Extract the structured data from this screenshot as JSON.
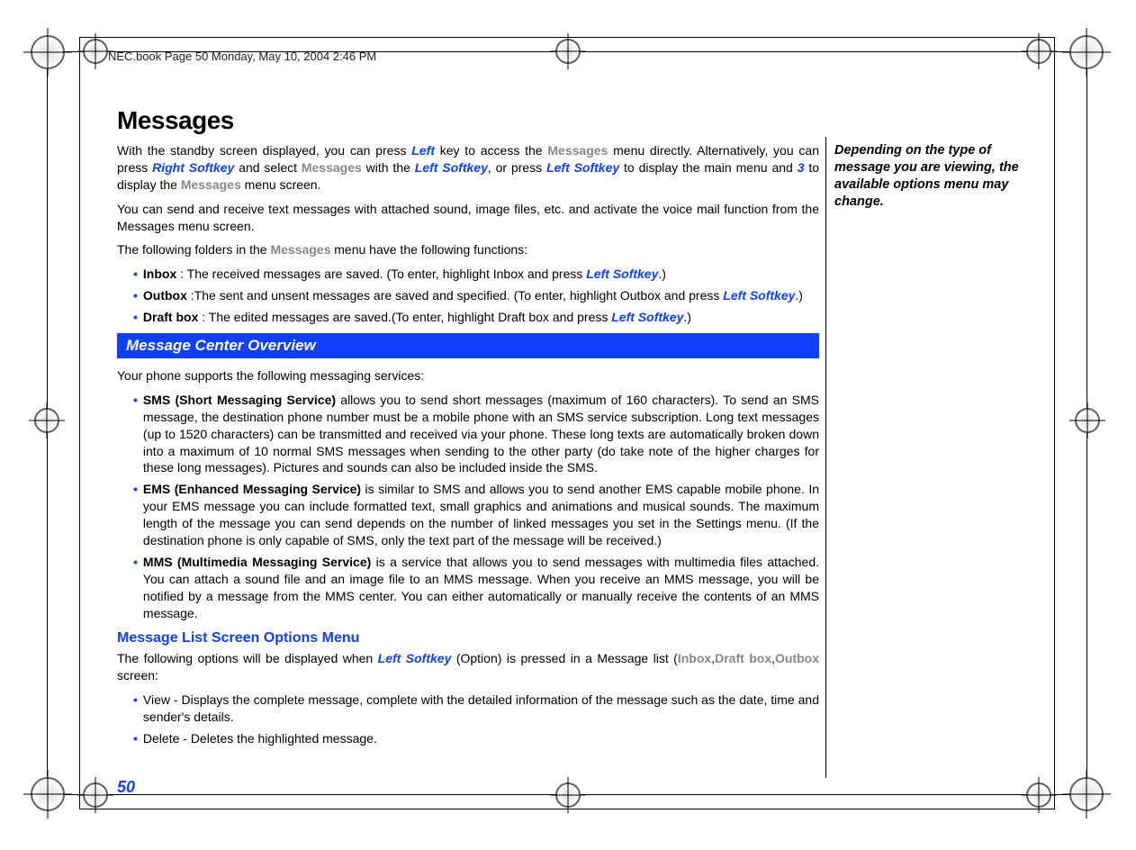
{
  "header": "NEC.book  Page 50  Monday, May 10, 2004  2:46 PM",
  "title": "Messages",
  "intro": {
    "p1_a": "With the standby screen displayed, you can press ",
    "k_left": "Left",
    "p1_b": " key to access the ",
    "ui_messages": "Messages",
    "p1_c": " menu directly. Alternatively, you can press ",
    "k_right_soft": "Right  Softkey",
    "p1_d": " and select ",
    "p1_e": " with the ",
    "k_left_soft": "Left Softkey",
    "p1_f": ", or press ",
    "p1_g": " to display the main menu and ",
    "k_3": "3",
    "p1_h": " to display the ",
    "p1_i": " menu screen."
  },
  "p2": "You can send and receive text messages with attached sound, image files, etc. and activate the voice mail function from the Messages menu screen.",
  "p3_a": "The following folders in the ",
  "p3_b": " menu have the following functions:",
  "folders": {
    "inbox_label": "Inbox",
    "inbox_text_a": " : The received messages are saved. (To enter, highlight Inbox and press ",
    "inbox_text_b": ".)",
    "outbox_label": "Outbox",
    "outbox_text_a": " :The sent and unsent messages are saved and specified. (To enter, highlight Outbox and press ",
    "outbox_text_b": ".)",
    "draft_label": "Draft box",
    "draft_text_a": " : The edited messages are saved.(To enter, highlight Draft box and press ",
    "draft_text_b": ".)"
  },
  "section_bar": "Message Center Overview",
  "overview_intro": "Your phone supports the following messaging services:",
  "services": {
    "sms_label": "SMS (Short Messaging Service)",
    "sms_text": " allows you to send short messages (maximum of 160 characters). To send an SMS message, the destination phone number must be a mobile phone with an SMS service subscription. Long text messages (up to 1520 characters) can be transmitted and received via your phone. These long texts are automatically broken down into a maximum of 10 normal SMS messages when sending to the other party (do take note of the higher charges for these long messages). Pictures and sounds can also be included inside the SMS.",
    "ems_label": "EMS (Enhanced Messaging Service)",
    "ems_text": " is similar to SMS and allows you to send another EMS capable mobile phone. In your EMS message you can include formatted text, small graphics and animations and musical sounds. The maximum length of the message you can send depends on the number of linked messages you set in the Settings menu. (If the destination phone is only capable of SMS, only the text part of the message will be received.)",
    "mms_label": "MMS (Multimedia Messaging Service)",
    "mms_text": " is a service that allows you to send messages with multimedia files attached. You can attach a sound file and an image file to an MMS message. When you receive an MMS message, you will be notified by a message from the MMS center. You can either automatically or manually receive the contents of an MMS message."
  },
  "subheading": "Message List Screen Options Menu",
  "options_intro_a": "The following options will be displayed when ",
  "options_intro_b": " (Option) is pressed in a  Message list (",
  "ui_inbox": "Inbox",
  "comma": ",",
  "ui_draft": "Draft box",
  "ui_outbox": "Outbox",
  "options_intro_c": " screen:",
  "opt_view": "View - Displays the complete message, complete with the detailed information of the message such as the date, time and sender's details.",
  "opt_delete": "Delete - Deletes the highlighted message.",
  "page_number": "50",
  "side_note": "Depending on the type of message you are viewing, the available options menu may change."
}
